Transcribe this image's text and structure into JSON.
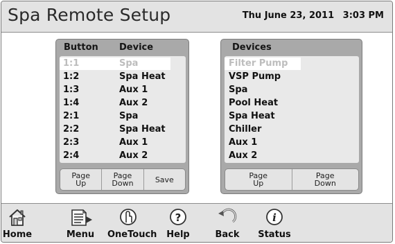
{
  "header": {
    "title": "Spa Remote Setup",
    "date": "Thu June 23, 2011",
    "time": "3:03 PM"
  },
  "button_panel": {
    "col_button": "Button",
    "col_device": "Device",
    "rows": [
      {
        "button": "1:1",
        "device": "Spa",
        "selected": true
      },
      {
        "button": "1:2",
        "device": "Spa Heat"
      },
      {
        "button": "1:3",
        "device": "Aux 1"
      },
      {
        "button": "1:4",
        "device": "Aux 2"
      },
      {
        "button": "2:1",
        "device": "Spa"
      },
      {
        "button": "2:2",
        "device": "Spa Heat"
      },
      {
        "button": "2:3",
        "device": "Aux 1"
      },
      {
        "button": "2:4",
        "device": "Aux 2"
      }
    ],
    "buttons": {
      "page_up": [
        "Page",
        "Up"
      ],
      "page_down": [
        "Page",
        "Down"
      ],
      "save": "Save"
    }
  },
  "devices_panel": {
    "title": "Devices",
    "items": [
      "Filter Pump",
      "VSP Pump",
      "Spa",
      "Pool Heat",
      "Spa Heat",
      "Chiller",
      "Aux 1",
      "Aux 2"
    ],
    "selected_index": 0,
    "buttons": {
      "page_up": [
        "Page",
        "Up"
      ],
      "page_down": [
        "Page",
        "Down"
      ]
    }
  },
  "footer": {
    "nav": [
      {
        "label": "Home",
        "icon": "home-icon"
      },
      {
        "label": "Menu",
        "icon": "menu-icon"
      },
      {
        "label": "OneTouch",
        "icon": "onetouch-icon"
      },
      {
        "label": "Help",
        "icon": "help-icon"
      },
      {
        "label": "Back",
        "icon": "back-icon"
      },
      {
        "label": "Status",
        "icon": "status-icon"
      }
    ]
  },
  "colors": {
    "panel_bg": "#a9a9a9",
    "list_bg": "#e9e9e9",
    "header_bg": "#e3e3e3",
    "selected_text": "#bdbdbd"
  }
}
